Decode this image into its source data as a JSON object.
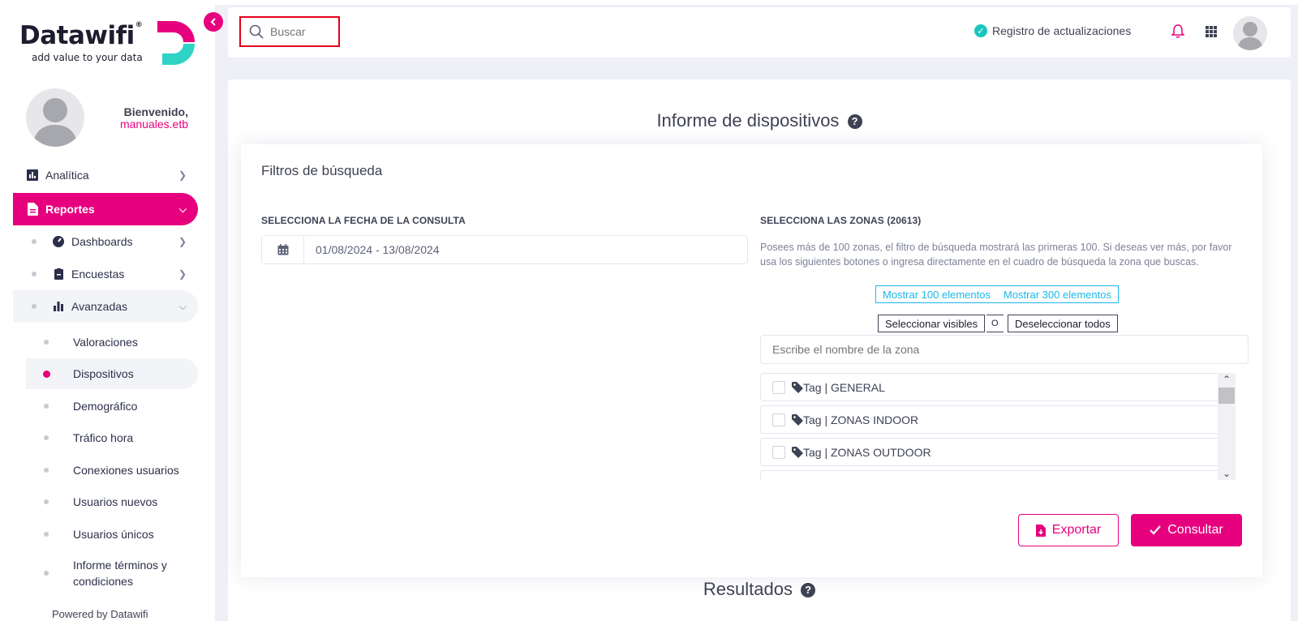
{
  "sidebar": {
    "logo": {
      "name": "Datawifi",
      "reg": "®",
      "tagline": "add value to your data"
    },
    "welcome": "Bienvenido,",
    "username": "manuales.etb",
    "items": {
      "analitica": "Analítica",
      "reportes": "Reportes",
      "dashboards": "Dashboards",
      "encuestas": "Encuestas",
      "avanzadas": "Avanzadas",
      "valoraciones": "Valoraciones",
      "dispositivos": "Dispositivos",
      "demografico": "Demográfico",
      "trafico": "Tráfico hora",
      "conexiones": "Conexiones usuarios",
      "nuevos": "Usuarios nuevos",
      "unicos": "Usuarios únicos",
      "terminos": "Informe términos y condiciones"
    },
    "powered": "Powered by Datawifi"
  },
  "topbar": {
    "search_placeholder": "Buscar",
    "registro": "Registro de actualizaciones"
  },
  "main": {
    "title": "Informe de dispositivos",
    "card_title": "Filtros de búsqueda",
    "date_label": "SELECCIONA LA FECHA DE LA CONSULTA",
    "date_value": "01/08/2024 - 13/08/2024",
    "zones_label": "SELECCIONA LAS ZONAS (20613)",
    "zones_desc": "Posees más de 100 zonas, el filtro de búsqueda mostrará las primeras 100. Si deseas ver más, por favor usa los siguientes botones o ingresa directamente en el cuadro de búsqueda la zona que buscas.",
    "btn_100": "Mostrar 100 elementos",
    "btn_300": "Mostrar 300 elementos",
    "btn_select": "Seleccionar visibles",
    "btn_o": "O",
    "btn_deselect": "Deseleccionar todos",
    "zone_placeholder": "Escribe el nombre de la zona",
    "zones": [
      "Tag | GENERAL",
      "Tag | ZONAS INDOOR",
      "Tag | ZONAS OUTDOOR"
    ],
    "export_label": "Exportar",
    "consultar_label": "Consultar",
    "results_title": "Resultados"
  },
  "colors": {
    "accent": "#e6007e",
    "info": "#1cb8e8",
    "success": "#1bc5bd",
    "search_highlight": "#e3001b"
  }
}
